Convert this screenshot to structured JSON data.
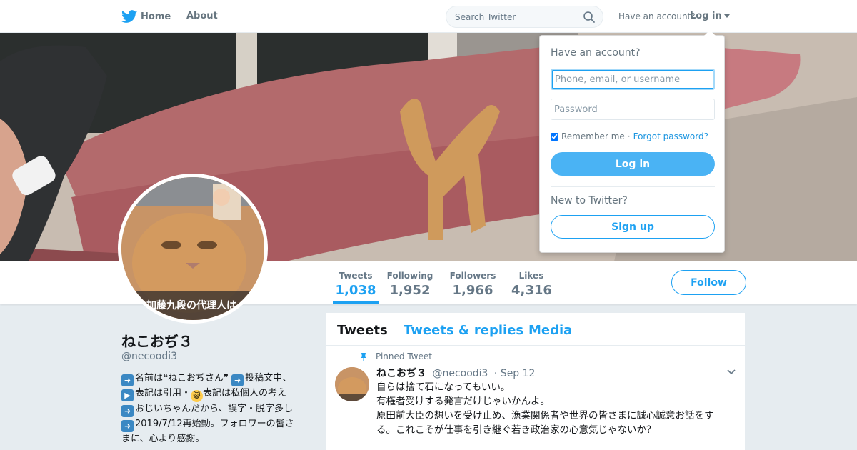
{
  "nav": {
    "home_label": "Home",
    "about_label": "About",
    "search_placeholder": "Search Twitter",
    "have_account": "Have an account?",
    "login_label": "Log in"
  },
  "avatar_caption": "加藤九段の代理人は",
  "profile_nav": {
    "stats": [
      {
        "label": "Tweets",
        "value": "1,038"
      },
      {
        "label": "Following",
        "value": "1,952"
      },
      {
        "label": "Followers",
        "value": "1,966"
      },
      {
        "label": "Likes",
        "value": "4,316"
      }
    ],
    "follow_label": "Follow"
  },
  "profile": {
    "name": "ねこおぢ３",
    "handle": "@necoodi3",
    "bio_lines": [
      "名前は❝ねこおぢさん❞",
      "投稿文中、",
      "表記は引用・",
      "表記は私個人の考え",
      "おじいちゃんだから、誤字・脱字多し",
      "2019/7/12再始動。フォロワーの皆さ",
      "まに、心より感謝。"
    ]
  },
  "timeline": {
    "tabs": [
      "Tweets",
      "Tweets & replies",
      "Media"
    ],
    "pinned_label": "Pinned Tweet",
    "tweet": {
      "name": "ねこおぢ３",
      "handle": "@necoodi3",
      "date": "· Sep 12",
      "lines": [
        "自らは捨て石になってもいい。",
        "有権者受けする発言だけじゃいかんよ。",
        "原田前大臣の想いを受け止め、漁業関係者や世界の皆さまに誠心誠意お話をす",
        "る。これこそが仕事を引き継ぐ若き政治家の心意気じゃないか？"
      ]
    }
  },
  "login_dropdown": {
    "title": "Have an account?",
    "username_placeholder": "Phone, email, or username",
    "password_placeholder": "Password",
    "remember_label": "Remember me",
    "separator": "·",
    "forgot_label": "Forgot password?",
    "login_button": "Log in",
    "new_label": "New to Twitter?",
    "signup_button": "Sign up"
  },
  "colors": {
    "accent": "#1da1f2",
    "login_button_bg": "#4ab3f4",
    "text_secondary": "#657786"
  }
}
